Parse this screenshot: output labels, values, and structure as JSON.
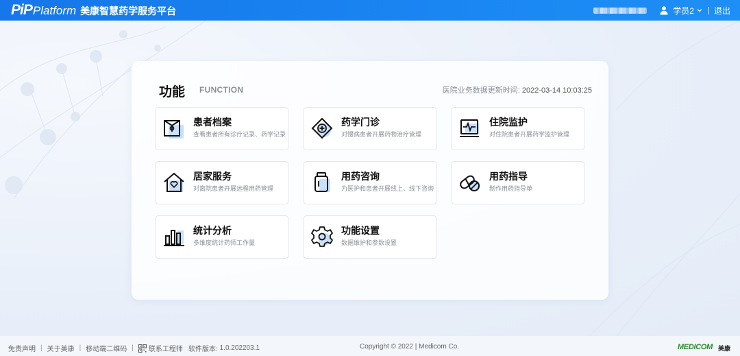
{
  "header": {
    "brand_logo": "PiP",
    "brand_sub": "Platform",
    "brand_cn": "美康智慧药学服务平台",
    "user_label": "学员2",
    "logout_label": "退出",
    "icons": [
      "user-icon",
      "chevron-down-icon"
    ]
  },
  "panel": {
    "title": "功能",
    "subtitle": "FUNCTION",
    "update_label": "医院业务数据更新时间:",
    "update_time": "2022-03-14 10:03:25"
  },
  "tiles": [
    {
      "title": "患者档案",
      "desc": "查看患者所有诊疗记录、药学记录",
      "icon": "patient-file-icon"
    },
    {
      "title": "药学门诊",
      "desc": "对慢病患者开展药物治疗管理",
      "icon": "medical-cross-icon"
    },
    {
      "title": "住院监护",
      "desc": "对住院患者开展药学监护管理",
      "icon": "heart-monitor-icon"
    },
    {
      "title": "居家服务",
      "desc": "对离院患者开展远程用药管理",
      "icon": "home-heart-icon"
    },
    {
      "title": "用药咨询",
      "desc": "为医护和患者开展线上、线下咨询",
      "icon": "medicine-bottle-icon"
    },
    {
      "title": "用药指导",
      "desc": "制作用药指导单",
      "icon": "pill-capsule-icon"
    },
    {
      "title": "统计分析",
      "desc": "多维度统计药师工作量",
      "icon": "bar-chart-icon"
    },
    {
      "title": "功能设置",
      "desc": "数据维护和参数设置",
      "icon": "gear-icon"
    }
  ],
  "footer": {
    "disclaimer": "免责声明",
    "about": "关于美康",
    "mobile_qr": "移动端二维码",
    "contact": "联系工程师",
    "version_label": "软件版本:",
    "version": "1.0.202203.1",
    "copyright": "Copyright © 2022 | Medicom Co.",
    "medicom_logo": "MEDICOM",
    "medicom_cn": "美康"
  },
  "colors": {
    "header_blue": "#1677ea",
    "icon_blue": "#c9e0fb",
    "logo_green": "#2f8a2e"
  }
}
